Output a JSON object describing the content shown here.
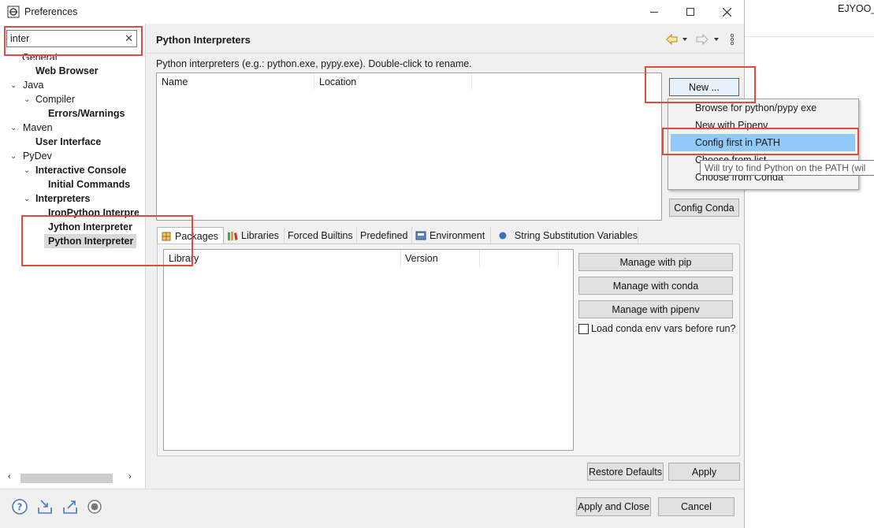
{
  "window": {
    "title": "Preferences",
    "minimize": "—",
    "maximize": "☐",
    "close": "✕"
  },
  "outside": {
    "user_label": "EJYOO_"
  },
  "filter": {
    "value": "inter",
    "clear": "✕"
  },
  "tree": {
    "general": "General",
    "web_browser": "Web Browser",
    "java": "Java",
    "compiler": "Compiler",
    "errors_warnings": "Errors/Warnings",
    "maven": "Maven",
    "user_interface": "User Interface",
    "pydev": "PyDev",
    "interactive_console": "Interactive Console",
    "initial_commands": "Initial Commands",
    "interpreters": "Interpreters",
    "ironpython": "IronPython Interpre",
    "jython": "Jython Interpreter",
    "python": "Python Interpreter"
  },
  "page": {
    "title": "Python Interpreters",
    "description": "Python interpreters (e.g.: python.exe, pypy.exe).   Double-click to rename."
  },
  "interpreters_table": {
    "columns": [
      "Name",
      "Location"
    ]
  },
  "buttons": {
    "new": "New ...",
    "config_conda": "Config Conda",
    "manage_pip": "Manage with pip",
    "manage_conda": "Manage with conda",
    "manage_pipenv": "Manage with pipenv",
    "restore_defaults": "Restore Defaults",
    "apply": "Apply",
    "apply_close": "Apply and Close",
    "cancel": "Cancel"
  },
  "new_menu": {
    "items": [
      "Browse for python/pypy exe",
      "New with Pipenv",
      "Config first in PATH",
      "Choose from list",
      "Choose from Conda"
    ],
    "highlighted_index": 2
  },
  "tooltip": "Will try to find Python on the PATH (wil",
  "tabs": [
    "Packages",
    "Libraries",
    "Forced Builtins",
    "Predefined",
    "Environment",
    "String Substitution Variables"
  ],
  "packages_table": {
    "columns": [
      "Library",
      "Version"
    ]
  },
  "checkbox": {
    "label": "Load conda env vars before run?",
    "checked": false
  },
  "colors": {
    "highlight": "#91c9f7",
    "annotation": "#e04a3f",
    "focus": "#0078d7"
  }
}
